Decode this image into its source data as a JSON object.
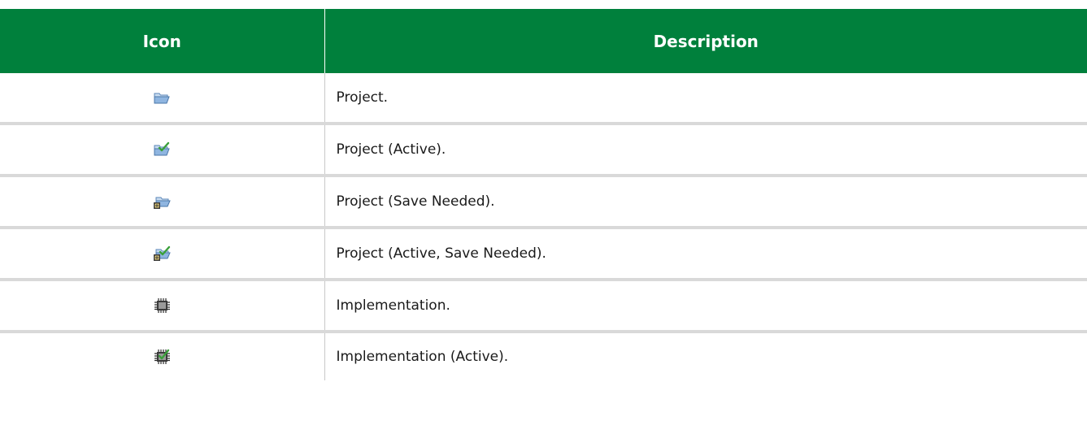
{
  "table": {
    "headers": {
      "icon": "Icon",
      "description": "Description"
    },
    "rows": [
      {
        "icon": "project-folder-icon",
        "description": "Project."
      },
      {
        "icon": "project-active-icon",
        "description": "Project (Active)."
      },
      {
        "icon": "project-save-needed-icon",
        "description": "Project (Save Needed)."
      },
      {
        "icon": "project-active-save-needed-icon",
        "description": "Project (Active, Save Needed)."
      },
      {
        "icon": "implementation-chip-icon",
        "description": "Implementation."
      },
      {
        "icon": "implementation-active-icon",
        "description": "Implementation (Active)."
      }
    ]
  },
  "colors": {
    "header_background": "#00803c",
    "header_text": "#ffffff",
    "row_separator": "#d9d9d9",
    "checkmark_green": "#3aa03a",
    "folder_blue": "#7aa6d8"
  }
}
